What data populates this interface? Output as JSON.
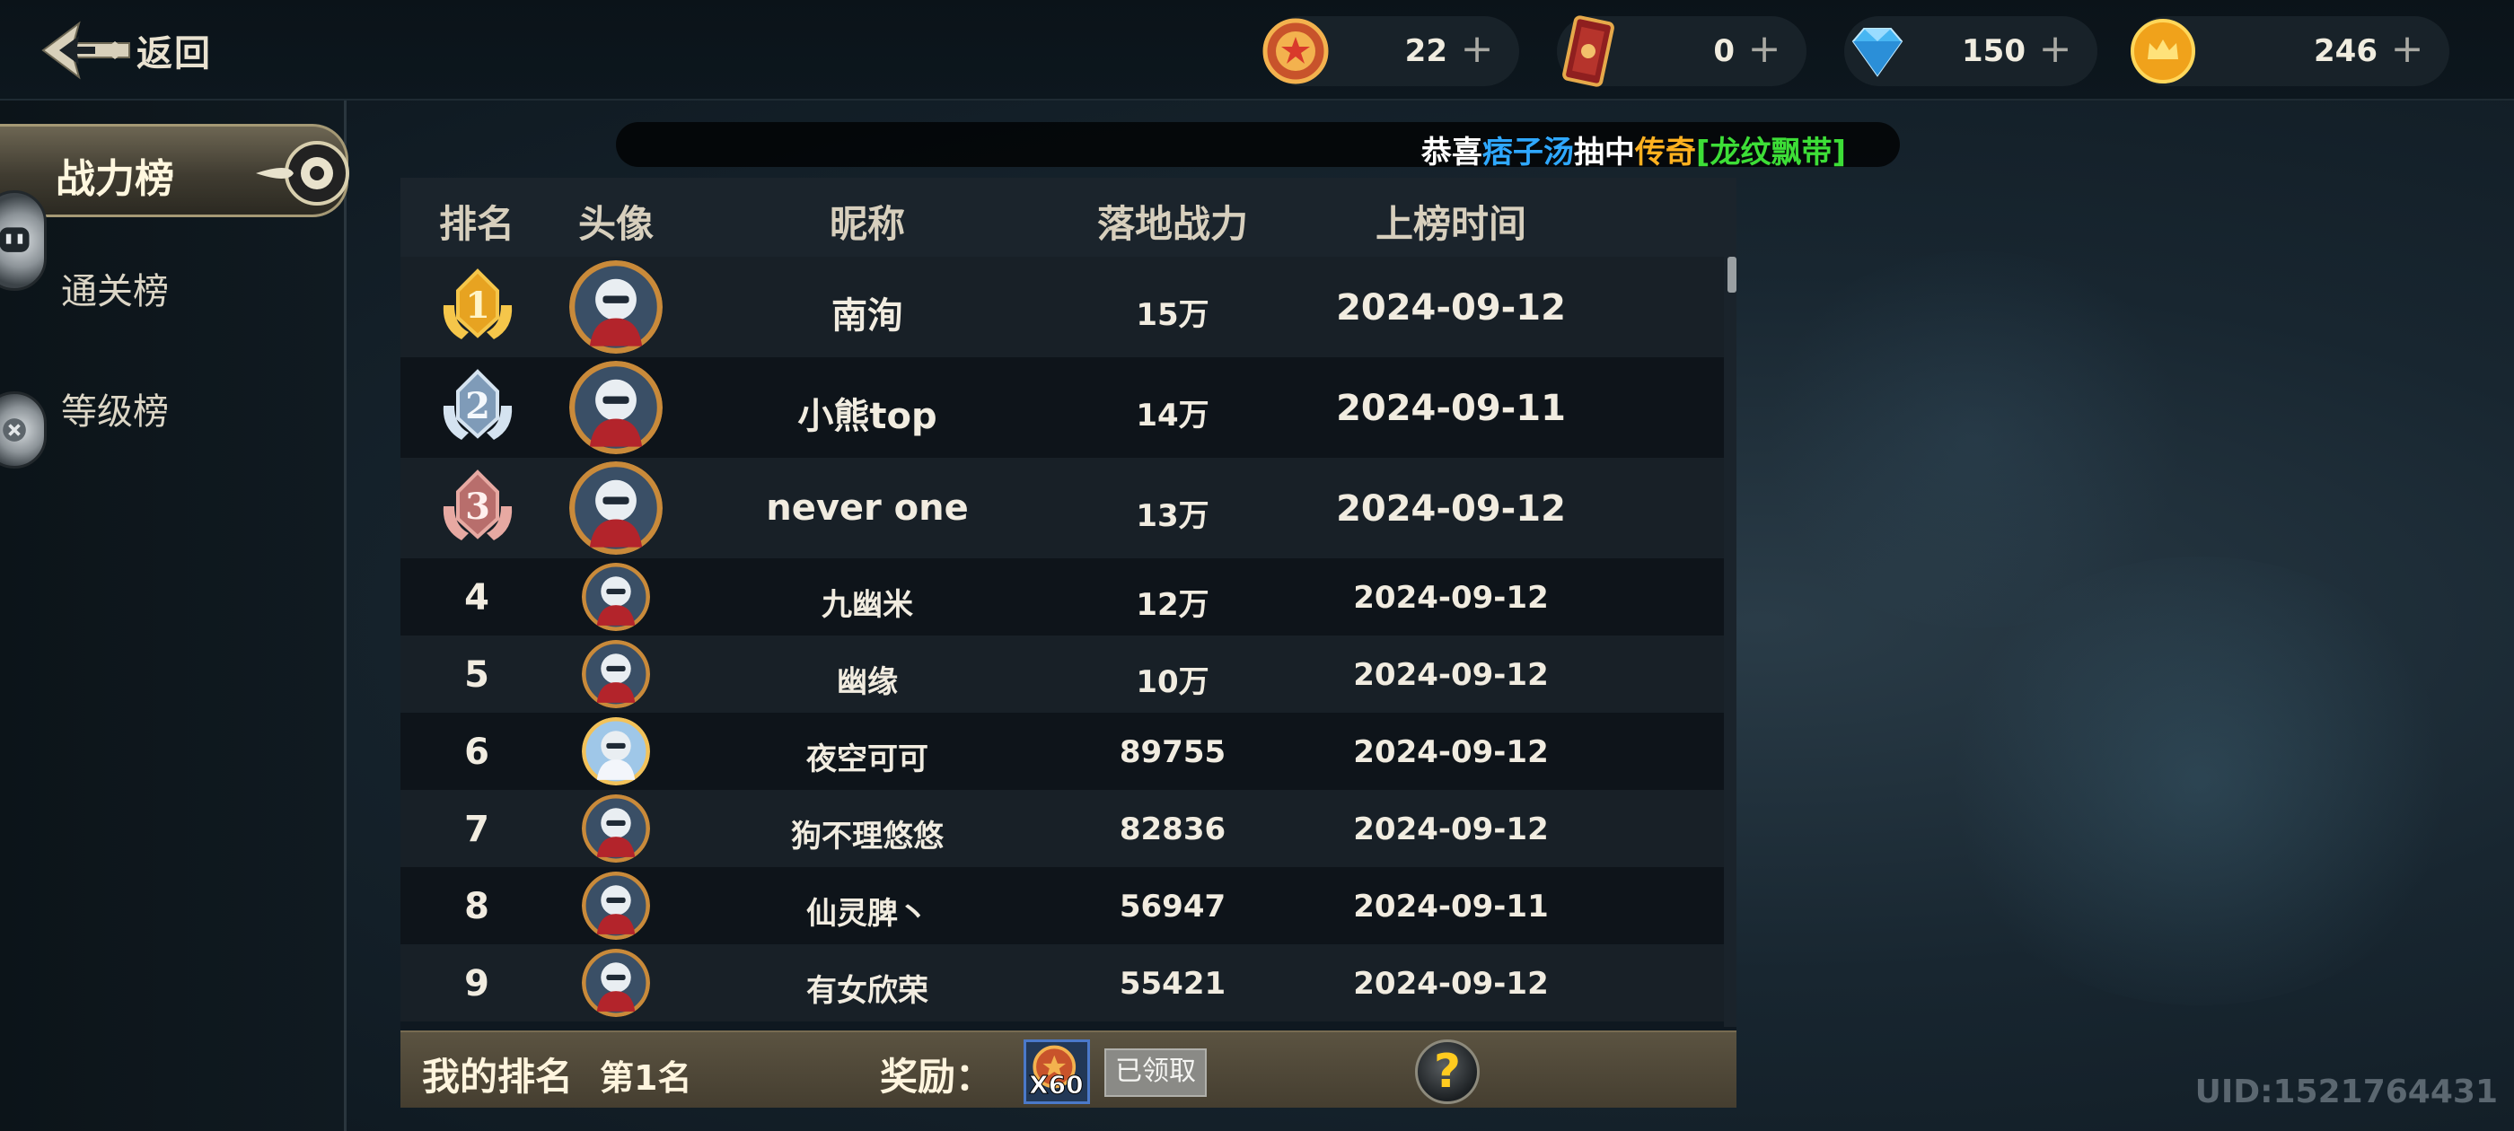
{
  "header": {
    "back_label": "返回",
    "currencies": [
      {
        "name": "medal",
        "value": "22",
        "plus": "+"
      },
      {
        "name": "card",
        "value": "0",
        "plus": "+"
      },
      {
        "name": "diamond",
        "value": "150",
        "plus": "+"
      },
      {
        "name": "gold",
        "value": "246",
        "plus": "+"
      }
    ]
  },
  "sidebar": {
    "tabs": [
      {
        "label": "战力榜",
        "active": true
      },
      {
        "label": "通关榜",
        "active": false
      },
      {
        "label": "等级榜",
        "active": false
      }
    ]
  },
  "broadcast": {
    "prefix": "恭喜",
    "player": "痞子汤",
    "mid": "抽中",
    "rarity": "传奇",
    "item": "[龙纹飘带]",
    "colors": {
      "player": "#2fa8ff",
      "rarity": "#ffb11f",
      "item": "#3dde37",
      "base": "#ffffff"
    }
  },
  "table": {
    "headers": [
      "排名",
      "头像",
      "昵称",
      "落地战力",
      "上榜时间"
    ],
    "rows": [
      {
        "rank": "1",
        "nickname": "南洵",
        "power": "15万",
        "date": "2024-09-12"
      },
      {
        "rank": "2",
        "nickname": "小熊top",
        "power": "14万",
        "date": "2024-09-11"
      },
      {
        "rank": "3",
        "nickname": "never one",
        "power": "13万",
        "date": "2024-09-12"
      },
      {
        "rank": "4",
        "nickname": "九幽米",
        "power": "12万",
        "date": "2024-09-12"
      },
      {
        "rank": "5",
        "nickname": "幽缘",
        "power": "10万",
        "date": "2024-09-12"
      },
      {
        "rank": "6",
        "nickname": "夜空可可",
        "power": "89755",
        "date": "2024-09-12"
      },
      {
        "rank": "7",
        "nickname": "狗不理悠悠",
        "power": "82836",
        "date": "2024-09-12"
      },
      {
        "rank": "8",
        "nickname": "仙灵脾丶",
        "power": "56947",
        "date": "2024-09-11"
      },
      {
        "rank": "9",
        "nickname": "有女欣荣",
        "power": "55421",
        "date": "2024-09-12"
      }
    ]
  },
  "footer": {
    "my_rank_label": "我的排名",
    "my_rank_value": "第1名",
    "reward_label": "奖励：",
    "reward_count": "X60",
    "claimed_label": "已领取",
    "help": "?"
  },
  "uid": "UID:1521764431"
}
